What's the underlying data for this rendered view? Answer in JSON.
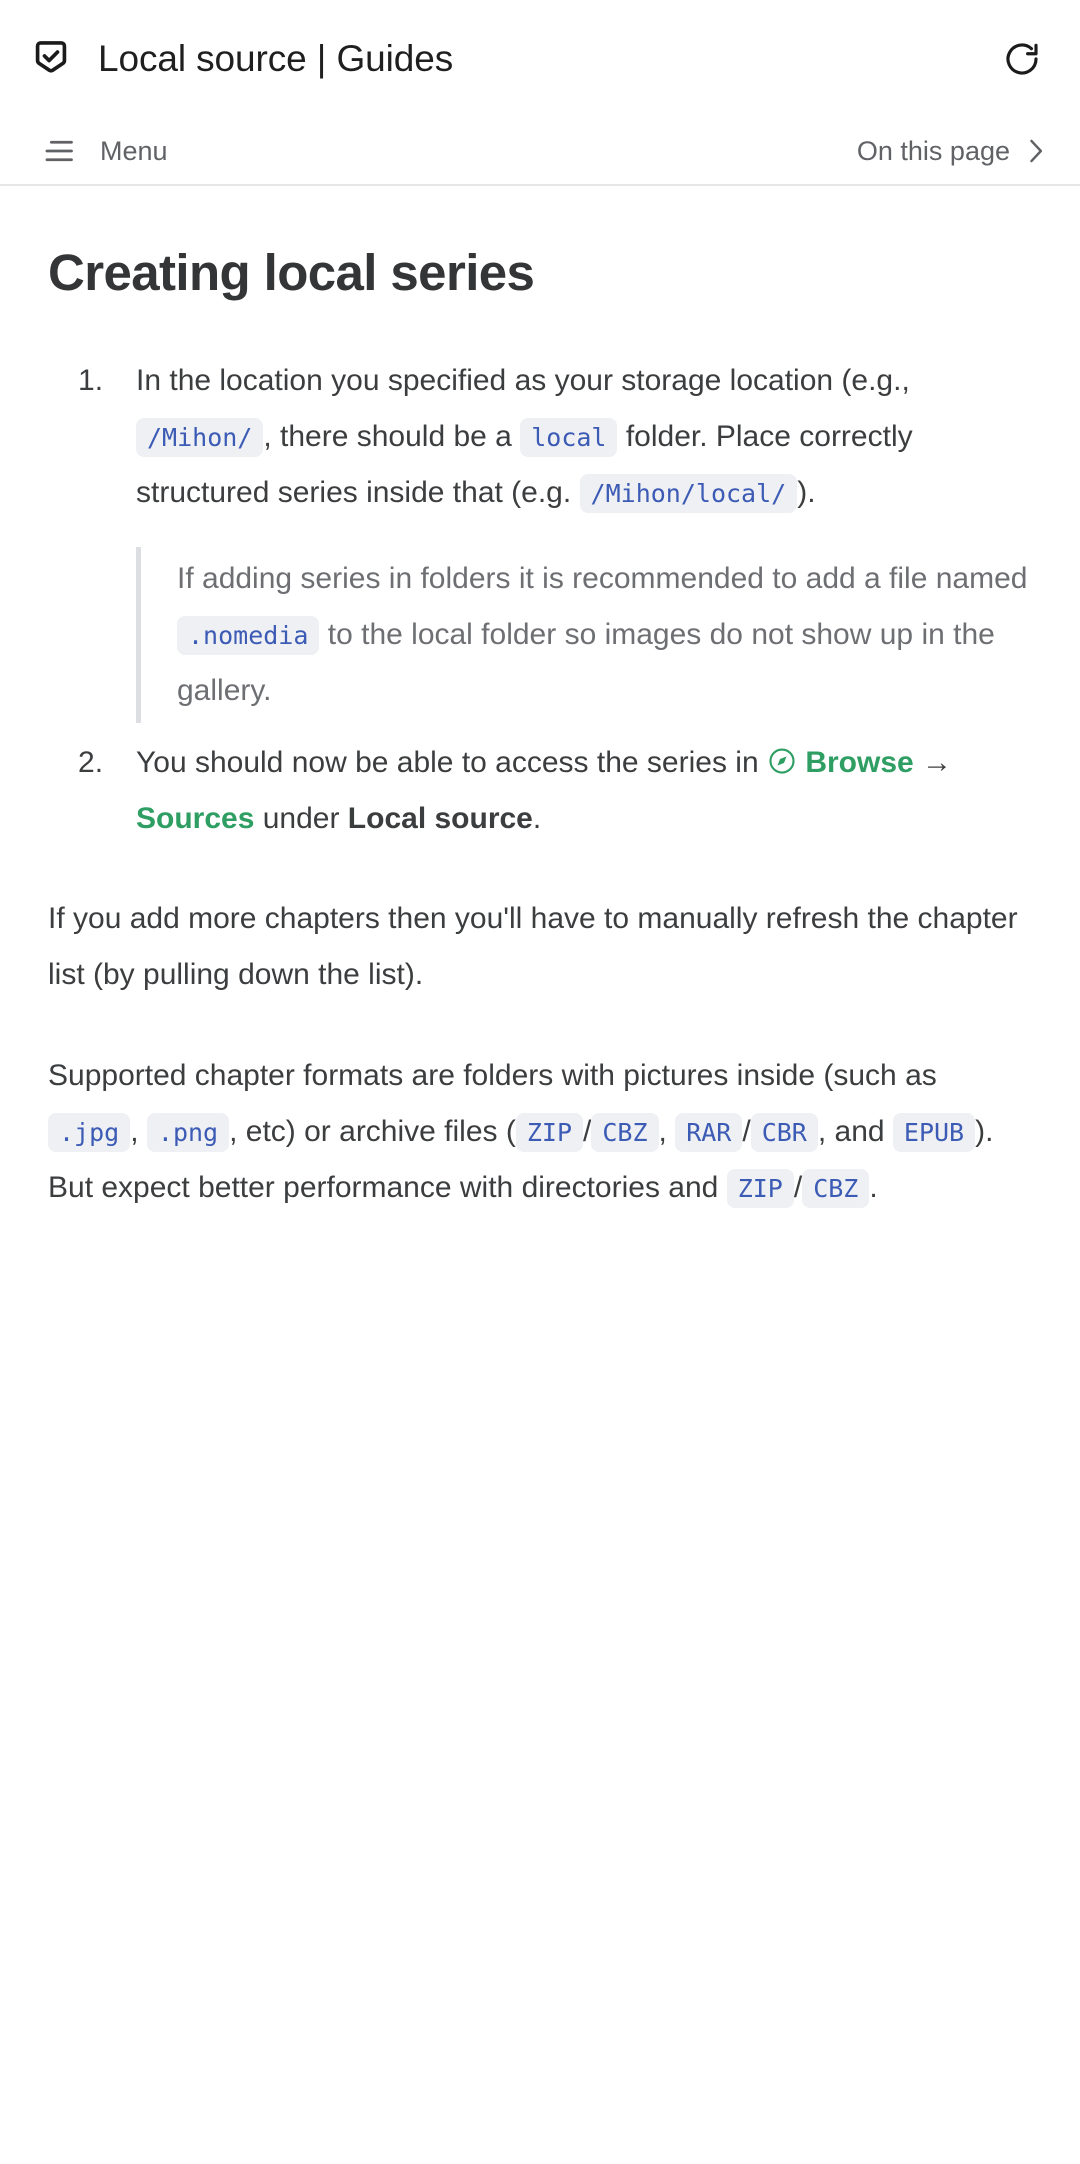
{
  "app_bar": {
    "security_icon": "shield-check-icon",
    "page_title": "Local source | Guides",
    "reload_icon": "reload-icon"
  },
  "docs_nav": {
    "menu_icon": "hamburger-icon",
    "menu_label": "Menu",
    "on_this_page_label": "On this page",
    "chevron_icon": "chevron-right-icon"
  },
  "article": {
    "heading": "Creating local series",
    "steps": [
      {
        "parts": [
          {
            "type": "text",
            "value": "In the location you specified as your storage location (e.g., "
          },
          {
            "type": "code",
            "value": "/Mihon/"
          },
          {
            "type": "text",
            "value": ", there should be a "
          },
          {
            "type": "code",
            "value": "local"
          },
          {
            "type": "text",
            "value": " folder. Place correctly structured series inside that (e.g. "
          },
          {
            "type": "code",
            "value": "/Mihon/local/"
          },
          {
            "type": "text",
            "value": ")."
          }
        ],
        "note": {
          "parts": [
            {
              "type": "text",
              "value": "If adding series in folders it is recommended to add a file named "
            },
            {
              "type": "code",
              "value": ".nomedia"
            },
            {
              "type": "text",
              "value": " to the local folder so images do not show up in the gallery."
            }
          ]
        }
      },
      {
        "parts": [
          {
            "type": "text",
            "value": "You should now be able to access the series in "
          },
          {
            "type": "icon",
            "value": "compass-icon"
          },
          {
            "type": "link",
            "value": "Browse"
          },
          {
            "type": "text",
            "value": " "
          },
          {
            "type": "arrow",
            "value": "→"
          },
          {
            "type": "text",
            "value": " "
          },
          {
            "type": "link",
            "value": "Sources"
          },
          {
            "type": "text",
            "value": " under "
          },
          {
            "type": "strong",
            "value": "Local source"
          },
          {
            "type": "text",
            "value": "."
          }
        ]
      }
    ],
    "paragraphs": [
      {
        "parts": [
          {
            "type": "text",
            "value": "If you add more chapters then you'll have to manually refresh the chapter list (by pulling down the list)."
          }
        ]
      },
      {
        "parts": [
          {
            "type": "text",
            "value": "Supported chapter formats are folders with pictures inside (such as "
          },
          {
            "type": "code",
            "value": ".jpg"
          },
          {
            "type": "text",
            "value": ", "
          },
          {
            "type": "code",
            "value": ".png"
          },
          {
            "type": "text",
            "value": ", etc) or archive files ("
          },
          {
            "type": "code",
            "value": "ZIP"
          },
          {
            "type": "text",
            "value": "/"
          },
          {
            "type": "code",
            "value": "CBZ"
          },
          {
            "type": "text",
            "value": ", "
          },
          {
            "type": "code",
            "value": "RAR"
          },
          {
            "type": "text",
            "value": "/"
          },
          {
            "type": "code",
            "value": "CBR"
          },
          {
            "type": "text",
            "value": ", and "
          },
          {
            "type": "code",
            "value": "EPUB"
          },
          {
            "type": "text",
            "value": "). But expect better performance with directories and "
          },
          {
            "type": "code",
            "value": "ZIP"
          },
          {
            "type": "text",
            "value": "/"
          },
          {
            "type": "code",
            "value": "CBZ"
          },
          {
            "type": "text",
            "value": "."
          }
        ]
      }
    ]
  },
  "colors": {
    "text": "#3b3d3f",
    "heading": "#343536",
    "muted": "#606266",
    "code_text": "#3b5bb5",
    "code_bg": "#eff0f4",
    "link_green": "#2e9e63",
    "divider": "#e6e6e8",
    "quote_border": "#dddee1"
  }
}
